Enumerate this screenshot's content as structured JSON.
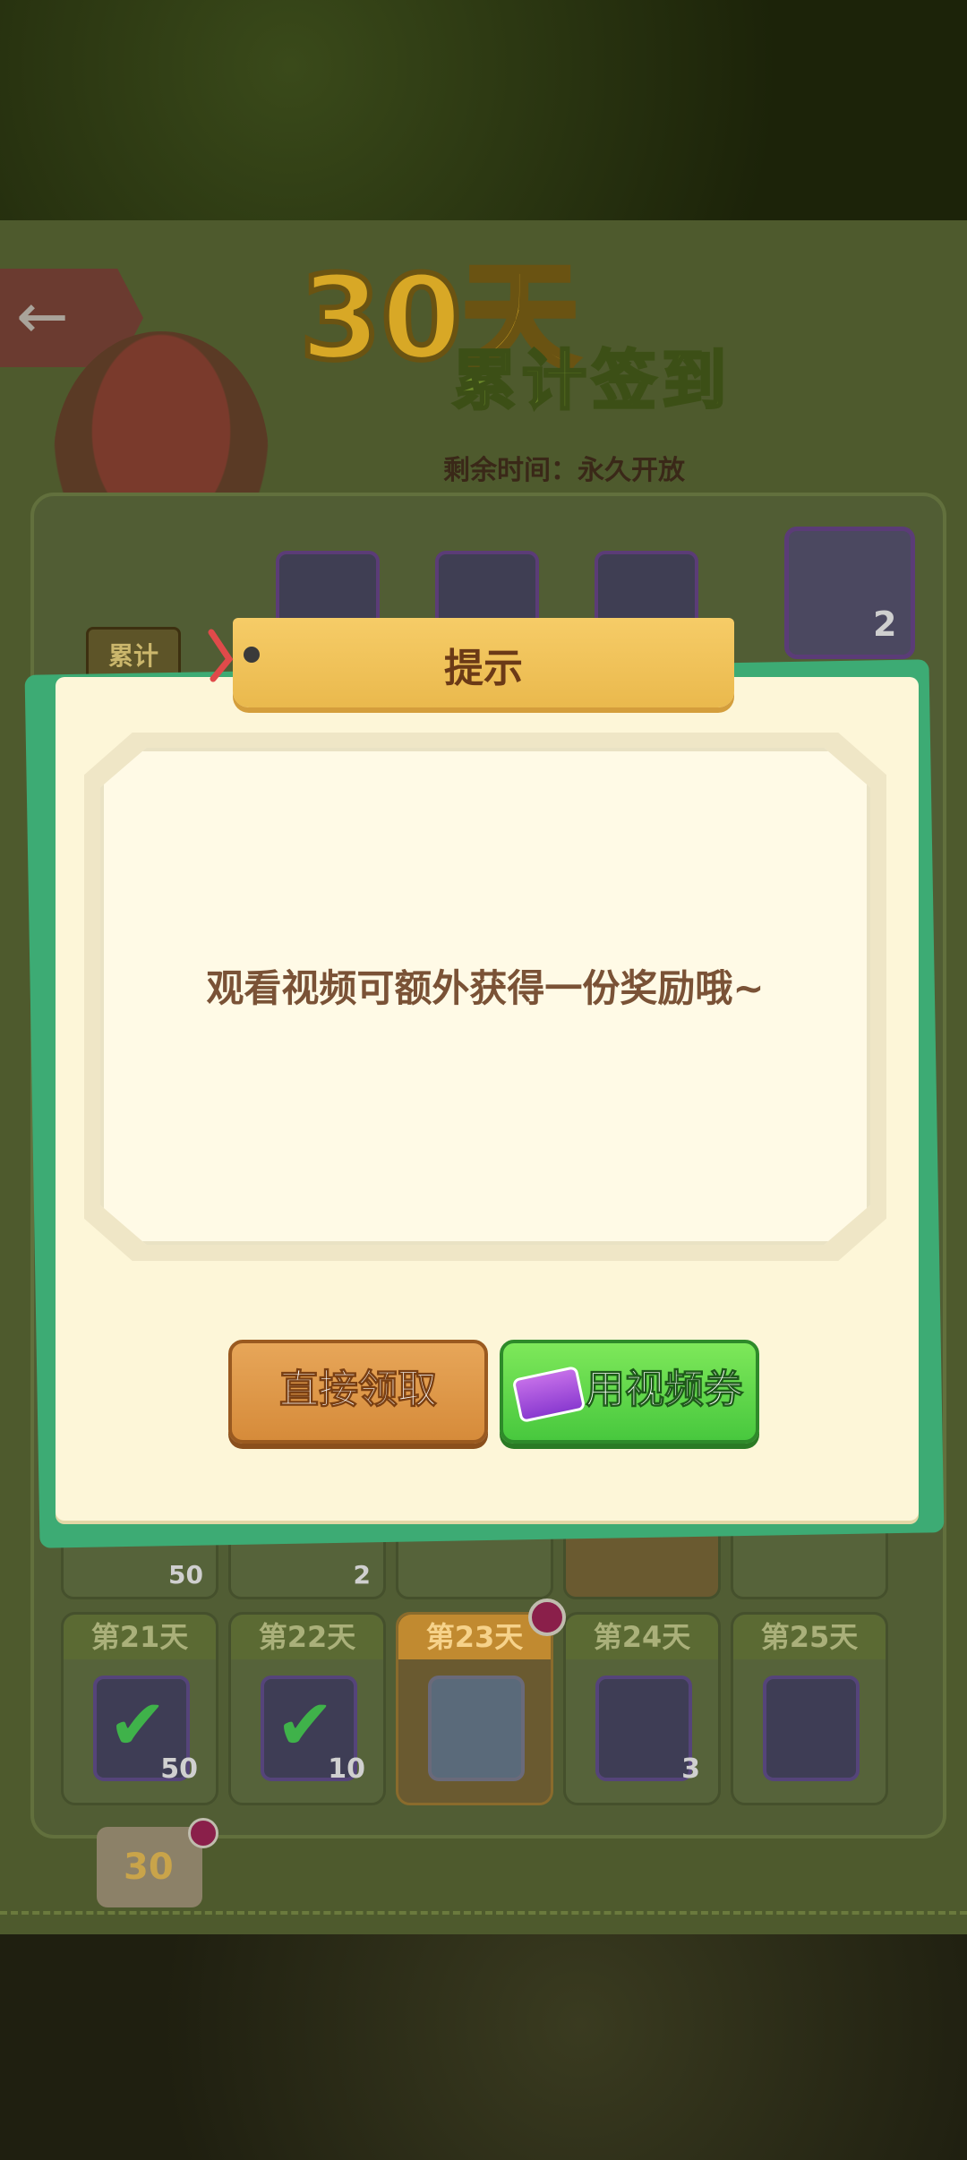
{
  "header": {
    "title_number": "30天",
    "title_sub": "累计签到",
    "remaining_label": "剩余时间：永久开放"
  },
  "rewards": {
    "big_reward_count": "2",
    "accumulated_tag": "累计"
  },
  "prev_row": [
    {
      "count": "50"
    },
    {
      "count": "2"
    },
    {
      "count": ""
    },
    {
      "count": ""
    },
    {
      "count": ""
    }
  ],
  "days": [
    {
      "label": "第21天",
      "count": "50",
      "checked": true
    },
    {
      "label": "第22天",
      "count": "10",
      "checked": true
    },
    {
      "label": "第23天",
      "count": "",
      "checked": false
    },
    {
      "label": "第24天",
      "count": "3",
      "checked": false
    },
    {
      "label": "第25天",
      "count": "",
      "checked": false
    }
  ],
  "calendar_icon_text": "30",
  "dialog": {
    "title": "提示",
    "message": "观看视频可额外获得一份奖励哦~",
    "direct_button": "直接领取",
    "video_button": "用视频券"
  },
  "colors": {
    "dialog_bg": "#fdf6d8",
    "accent_green": "#3dab74",
    "button_orange": "#d68b3a",
    "button_green": "#48c83e"
  }
}
